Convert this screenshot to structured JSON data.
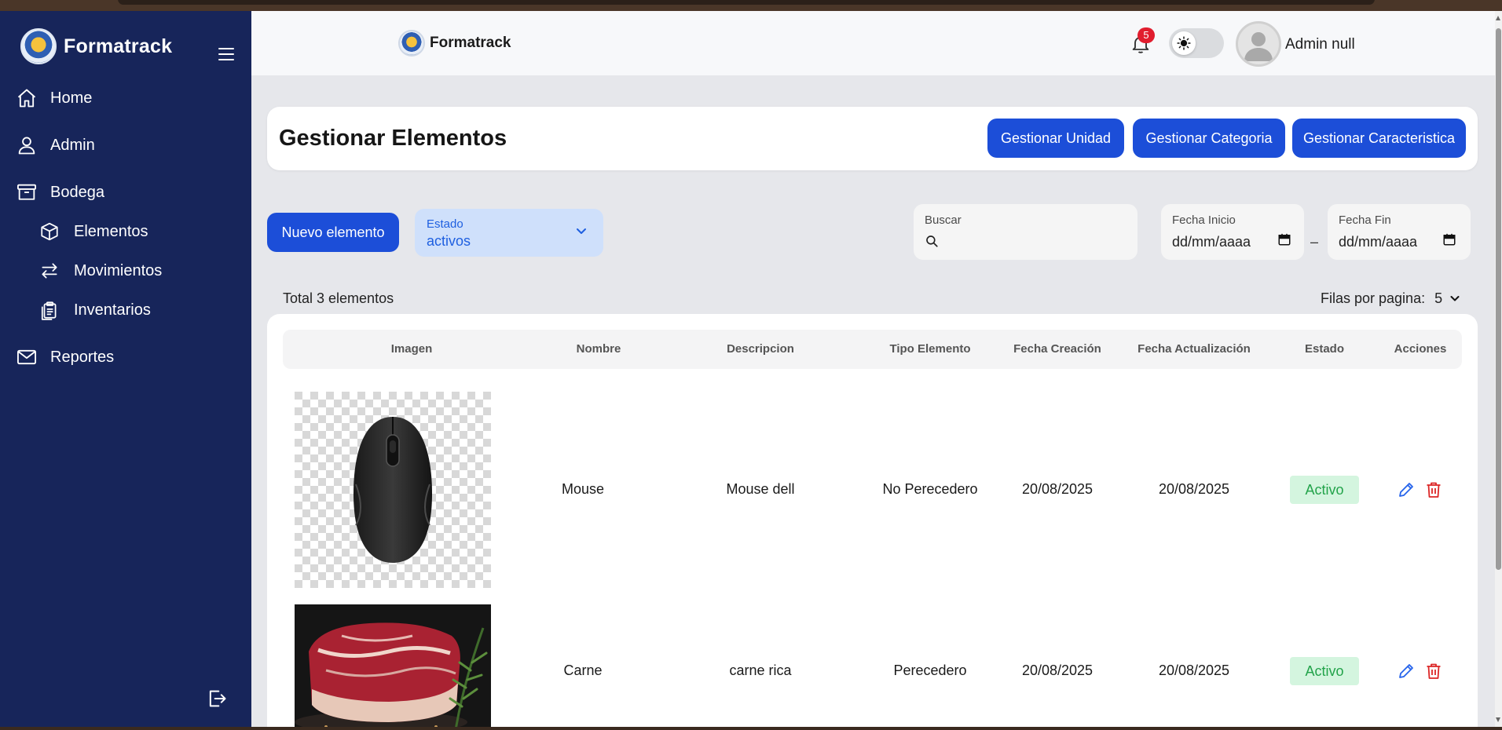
{
  "sidebar": {
    "brand": "Formatrack",
    "items": [
      {
        "label": "Home",
        "icon": "home-icon"
      },
      {
        "label": "Admin",
        "icon": "user-icon"
      },
      {
        "label": "Bodega",
        "icon": "archive-icon"
      },
      {
        "label": "Elementos",
        "icon": "cube-icon"
      },
      {
        "label": "Movimientos",
        "icon": "arrows-icon"
      },
      {
        "label": "Inventarios",
        "icon": "clipboard-icon"
      },
      {
        "label": "Reportes",
        "icon": "mail-icon"
      }
    ]
  },
  "header": {
    "brand": "Formatrack",
    "notifications_count": "5",
    "user_name": "Admin null"
  },
  "page": {
    "title": "Gestionar Elementos",
    "buttons": {
      "unidad": "Gestionar Unidad",
      "categoria": "Gestionar Categoria",
      "caracteristica": "Gestionar Caracteristica"
    }
  },
  "filters": {
    "new_button": "Nuevo elemento",
    "estado_label": "Estado",
    "estado_value": "activos",
    "buscar_label": "Buscar",
    "fecha_inicio_label": "Fecha Inicio",
    "fecha_inicio_value": "dd/mm/aaaa",
    "fecha_fin_label": "Fecha Fin",
    "fecha_fin_value": "dd/mm/aaaa",
    "range_separator": "–"
  },
  "summary": {
    "total": "Total 3 elementos",
    "rows_per_page_label": "Filas por pagina:",
    "rows_per_page_value": "5"
  },
  "table": {
    "columns": [
      "Imagen",
      "Nombre",
      "Descripcion",
      "Tipo Elemento",
      "Fecha Creación",
      "Fecha Actualización",
      "Estado",
      "Acciones"
    ],
    "rows": [
      {
        "nombre": "Mouse",
        "descripcion": "Mouse dell",
        "tipo": "No Perecedero",
        "creacion": "20/08/2025",
        "actualizacion": "20/08/2025",
        "estado": "Activo"
      },
      {
        "nombre": "Carne",
        "descripcion": "carne rica",
        "tipo": "Perecedero",
        "creacion": "20/08/2025",
        "actualizacion": "20/08/2025",
        "estado": "Activo"
      }
    ]
  },
  "colors": {
    "sidebar_bg": "#17255a",
    "primary_button": "#1c4ed8",
    "status_active_bg": "#d4f5df",
    "status_active_text": "#22a34a",
    "edit_icon": "#2563eb",
    "delete_icon": "#dc2626",
    "badge": "#e11d2e"
  }
}
